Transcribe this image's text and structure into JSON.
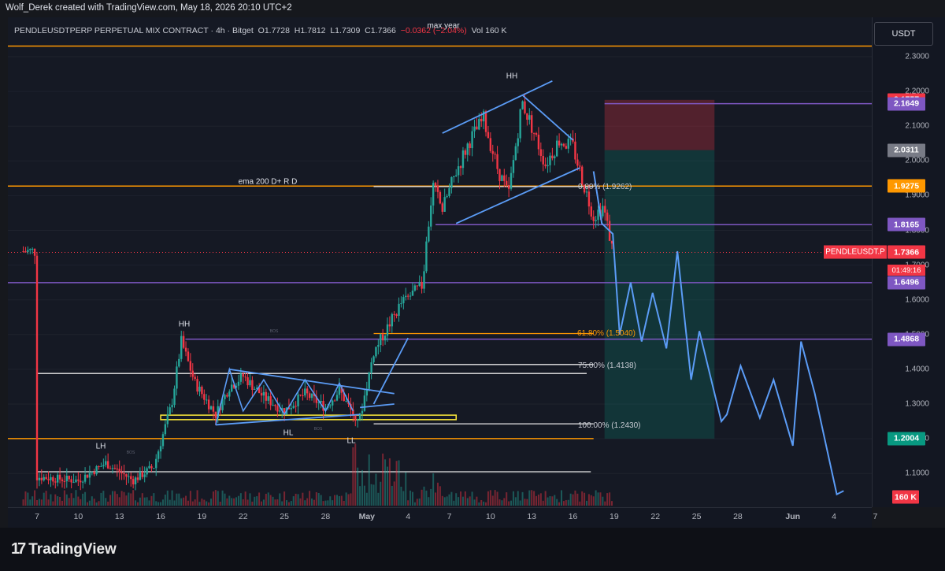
{
  "header": {
    "credit": "Wolf_Derek created with TradingView.com, May 18, 2026 20:10 UTC+2"
  },
  "legend": {
    "symbol": "PENDLEUSDTPERP PERPETUAL MIX CONTRACT · 4h · Bitget",
    "open": "O1.7728",
    "high": "H1.7812",
    "low": "L1.7309",
    "close": "C1.7366",
    "change": "−0.0362 (−2.04%)",
    "volume": "Vol 160 K"
  },
  "currency_button": "USDT",
  "branding": {
    "logo_mark": "17",
    "name": "TradingView"
  },
  "colors": {
    "up": "#26a69a",
    "down": "#f23645",
    "orange": "#ff9800",
    "purple": "#7e57c2",
    "blue_drawing": "#5b9cf6",
    "white_line": "#e8e8e8",
    "yellow_box": "#ffeb3b"
  },
  "price_labels": [
    {
      "text": "2.1757",
      "color": "#f23645"
    },
    {
      "text": "2.1649",
      "color": "#7e57c2"
    },
    {
      "text": "2.0311",
      "color": "#787b86"
    },
    {
      "text": "1.9275",
      "color": "#ff9800"
    },
    {
      "text": "1.8165",
      "color": "#7e57c2"
    },
    {
      "text": "1.6496",
      "color": "#7e57c2"
    },
    {
      "text": "1.4868",
      "color": "#7e57c2"
    },
    {
      "text": "1.2004",
      "color": "#089981"
    },
    {
      "text": "160 K",
      "color": "#f23645"
    }
  ],
  "current_price": {
    "symbol": "PENDLEUSDT.P",
    "price": "1.7366",
    "countdown": "01:49:16"
  },
  "annotations": {
    "max_year": "max year",
    "ema": "ema 200 D+ R D",
    "hh_top": "HH",
    "hh_left": "HH",
    "lh": "LH",
    "hl": "HL",
    "ll": "LL",
    "bos1": "BOS",
    "bos2": "BOS",
    "bos3": "BOS"
  },
  "fib_labels": {
    "f0": "0.00% (1.9262)",
    "f618": "61.80% (1.5040)",
    "f75": "75.00% (1.4138)",
    "f100": "100.00% (1.2430)"
  },
  "chart_data": {
    "type": "candlestick",
    "symbol": "PENDLEUSDTPERP",
    "timeframe": "4h",
    "ylim": [
      1.03,
      2.37
    ],
    "y_ticks": [
      2.3,
      2.2,
      2.1,
      2.0,
      1.9,
      1.8,
      1.7,
      1.6,
      1.5,
      1.4,
      1.3,
      1.2,
      1.1
    ],
    "x_ticks": [
      "7",
      "10",
      "13",
      "16",
      "19",
      "22",
      "25",
      "28",
      "May",
      "4",
      "7",
      "10",
      "13",
      "16",
      "19",
      "22",
      "25",
      "28",
      "Jun",
      "4",
      "7"
    ],
    "anchors": [
      {
        "day": 7,
        "price": 1.09
      },
      {
        "day": 10,
        "price": 1.08
      },
      {
        "day": 12,
        "price": 1.13
      },
      {
        "day": 14,
        "price": 1.08
      },
      {
        "day": 15.5,
        "price": 1.12
      },
      {
        "day": 16.8,
        "price": 1.3
      },
      {
        "day": 17.5,
        "price": 1.48
      },
      {
        "day": 18.5,
        "price": 1.36
      },
      {
        "day": 20,
        "price": 1.27
      },
      {
        "day": 21,
        "price": 1.35
      },
      {
        "day": 22,
        "price": 1.38
      },
      {
        "day": 23.5,
        "price": 1.32
      },
      {
        "day": 25,
        "price": 1.28
      },
      {
        "day": 26.5,
        "price": 1.33
      },
      {
        "day": 28,
        "price": 1.29
      },
      {
        "day": 29,
        "price": 1.34
      },
      {
        "day": 30,
        "price": 1.27
      },
      {
        "day": 30.5,
        "price": 1.26
      },
      {
        "day": 31.5,
        "price": 1.45
      },
      {
        "day": 32.5,
        "price": 1.52
      },
      {
        "day": 33.5,
        "price": 1.59
      },
      {
        "day": 35,
        "price": 1.64
      },
      {
        "day": 35.8,
        "price": 1.93
      },
      {
        "day": 36.5,
        "price": 1.86
      },
      {
        "day": 37.5,
        "price": 1.97
      },
      {
        "day": 38.5,
        "price": 2.06
      },
      {
        "day": 39.5,
        "price": 2.12
      },
      {
        "day": 40.5,
        "price": 1.98
      },
      {
        "day": 41.3,
        "price": 1.9
      },
      {
        "day": 42.3,
        "price": 2.17
      },
      {
        "day": 43,
        "price": 2.1
      },
      {
        "day": 44,
        "price": 1.99
      },
      {
        "day": 45,
        "price": 2.06
      },
      {
        "day": 46,
        "price": 2.04
      },
      {
        "day": 46.8,
        "price": 1.93
      },
      {
        "day": 47.5,
        "price": 1.84
      },
      {
        "day": 48.2,
        "price": 1.87
      },
      {
        "day": 48.9,
        "price": 1.74
      }
    ],
    "levels": [
      {
        "price": 2.3305,
        "color": "#ff9800",
        "label": "max year"
      },
      {
        "price": 2.1649,
        "color": "#7e57c2"
      },
      {
        "price": 1.9275,
        "color": "#ff9800"
      },
      {
        "price": 1.8165,
        "color": "#7e57c2"
      },
      {
        "price": 1.6496,
        "color": "#7e57c2"
      },
      {
        "price": 1.4868,
        "color": "#7e57c2"
      },
      {
        "price": 1.2004,
        "color": "#ff9800"
      }
    ],
    "position": {
      "entry": 2.0311,
      "stop": 2.1757,
      "target": 1.2004
    },
    "projection": [
      {
        "day": 47.5,
        "price": 1.97
      },
      {
        "day": 48.1,
        "price": 1.82
      },
      {
        "day": 48.9,
        "price": 1.79
      },
      {
        "day": 49.4,
        "price": 1.5
      },
      {
        "day": 50.2,
        "price": 1.65
      },
      {
        "day": 51,
        "price": 1.48
      },
      {
        "day": 51.8,
        "price": 1.62
      },
      {
        "day": 52.8,
        "price": 1.46
      },
      {
        "day": 53.6,
        "price": 1.74
      },
      {
        "day": 54.6,
        "price": 1.37
      },
      {
        "day": 55.2,
        "price": 1.51
      },
      {
        "day": 56.8,
        "price": 1.25
      },
      {
        "day": 57.2,
        "price": 1.27
      },
      {
        "day": 58.2,
        "price": 1.41
      },
      {
        "day": 59.6,
        "price": 1.26
      },
      {
        "day": 60.6,
        "price": 1.37
      },
      {
        "day": 62,
        "price": 1.18
      },
      {
        "day": 62.6,
        "price": 1.48
      },
      {
        "day": 63.6,
        "price": 1.33
      },
      {
        "day": 65.2,
        "price": 1.04
      },
      {
        "day": 65.7,
        "price": 1.05
      }
    ],
    "volume_last": "160 K"
  }
}
